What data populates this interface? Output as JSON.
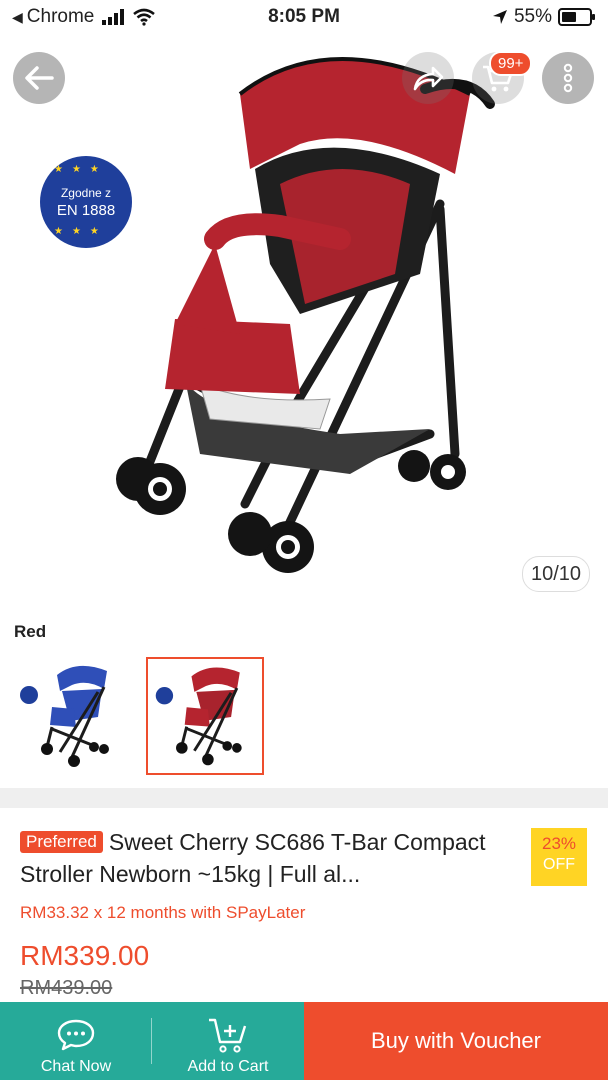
{
  "status_bar": {
    "back_app": "Chrome",
    "time": "8:05 PM",
    "battery_percent": "55%",
    "battery_level": 0.55
  },
  "header": {
    "cart_badge": "99+"
  },
  "gallery": {
    "counter": "10/10",
    "badge_line1": "Zgodne z",
    "badge_line2": "EN 1888",
    "stroller_color": "#b5242f"
  },
  "variants": {
    "label": "Red",
    "options": [
      {
        "name": "blue",
        "color": "#2f4fb8"
      },
      {
        "name": "red",
        "color": "#b5242f",
        "selected": true
      }
    ]
  },
  "product": {
    "badge": "Preferred",
    "title": "Sweet Cherry SC686 T-Bar Compact Stroller Newborn ~15kg | Full al...",
    "discount_pct": "23%",
    "discount_label": "OFF",
    "installment": "RM33.32 x 12 months with SPayLater",
    "price": "RM339.00",
    "original_price": "RM439.00"
  },
  "bottom_bar": {
    "chat_label": "Chat Now",
    "cart_label": "Add to Cart",
    "buy_label": "Buy with Voucher"
  },
  "colors": {
    "accent": "#ee4d2d",
    "teal": "#26aa99",
    "discount_bg": "#ffd424"
  }
}
